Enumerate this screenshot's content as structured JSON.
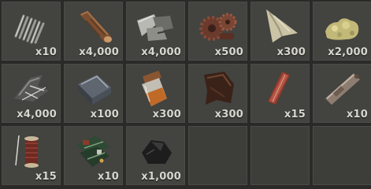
{
  "inventory": {
    "slots": [
      {
        "item_icon": "spring-icon",
        "quantity": "x10"
      },
      {
        "item_icon": "wood-log-icon",
        "quantity": "x4,000"
      },
      {
        "item_icon": "metal-fragments-icon",
        "quantity": "x4,000"
      },
      {
        "item_icon": "gears-icon",
        "quantity": "x500"
      },
      {
        "item_icon": "cloth-icon",
        "quantity": "x300"
      },
      {
        "item_icon": "sulfur-ore-icon",
        "quantity": "x2,000"
      },
      {
        "item_icon": "scrap-tarp-icon",
        "quantity": "x4,000"
      },
      {
        "item_icon": "high-quality-metal-icon",
        "quantity": "x100"
      },
      {
        "item_icon": "low-grade-fuel-jar-icon",
        "quantity": "x300"
      },
      {
        "item_icon": "leather-icon",
        "quantity": "x300"
      },
      {
        "item_icon": "road-sign-icon",
        "quantity": "x15"
      },
      {
        "item_icon": "metal-pipe-icon",
        "quantity": "x10"
      },
      {
        "item_icon": "sewing-kit-icon",
        "quantity": "x15"
      },
      {
        "item_icon": "tech-trash-icon",
        "quantity": "x10"
      },
      {
        "item_icon": "coal-icon",
        "quantity": "x1,000"
      },
      {
        "item_icon": "",
        "quantity": ""
      },
      {
        "item_icon": "",
        "quantity": ""
      },
      {
        "item_icon": "",
        "quantity": ""
      }
    ]
  }
}
